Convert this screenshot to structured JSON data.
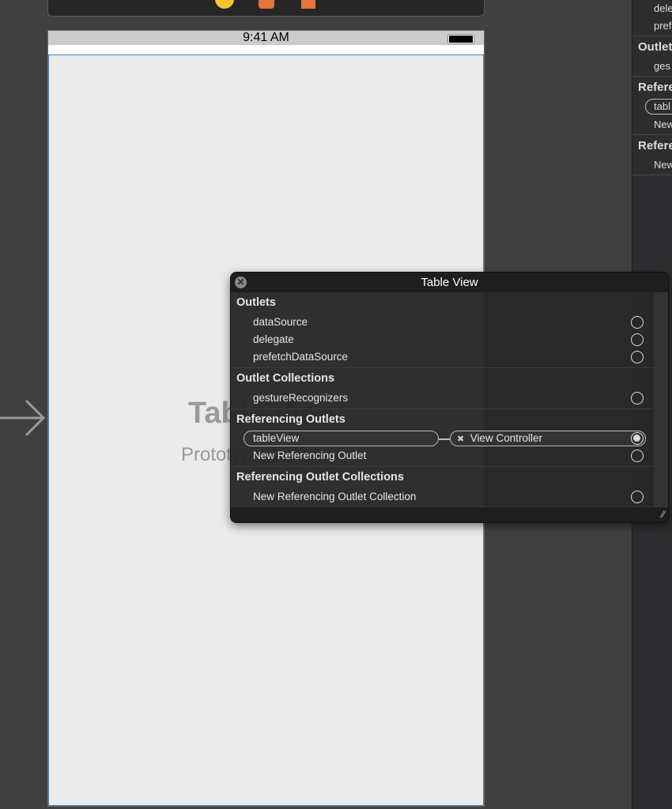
{
  "statusbar": {
    "time": "9:41 AM"
  },
  "canvas": {
    "title": "Table View",
    "subtitle": "Prototype Content"
  },
  "right_panel": {
    "items": [
      "dele",
      "pref"
    ],
    "headers": [
      "Outlet",
      "Refere",
      "Refere"
    ],
    "sub": [
      "ges",
      "tabl",
      "New",
      "New"
    ]
  },
  "popup": {
    "title": "Table View",
    "sections": [
      {
        "label": "Outlets",
        "rows": [
          "dataSource",
          "delegate",
          "prefetchDataSource"
        ]
      },
      {
        "label": "Outlet Collections",
        "rows": [
          "gestureRecognizers"
        ]
      },
      {
        "label": "Referencing Outlets",
        "connection": {
          "outlet": "tableView",
          "target": "View Controller"
        },
        "rows": [
          "New Referencing Outlet"
        ]
      },
      {
        "label": "Referencing Outlet Collections",
        "rows": [
          "New Referencing Outlet Collection"
        ]
      }
    ]
  },
  "colors": {
    "canvas": "#404040",
    "selection": "#4a7fbf",
    "toolbar_yellow": "#f5c530",
    "toolbar_orange": "#e8743b"
  }
}
